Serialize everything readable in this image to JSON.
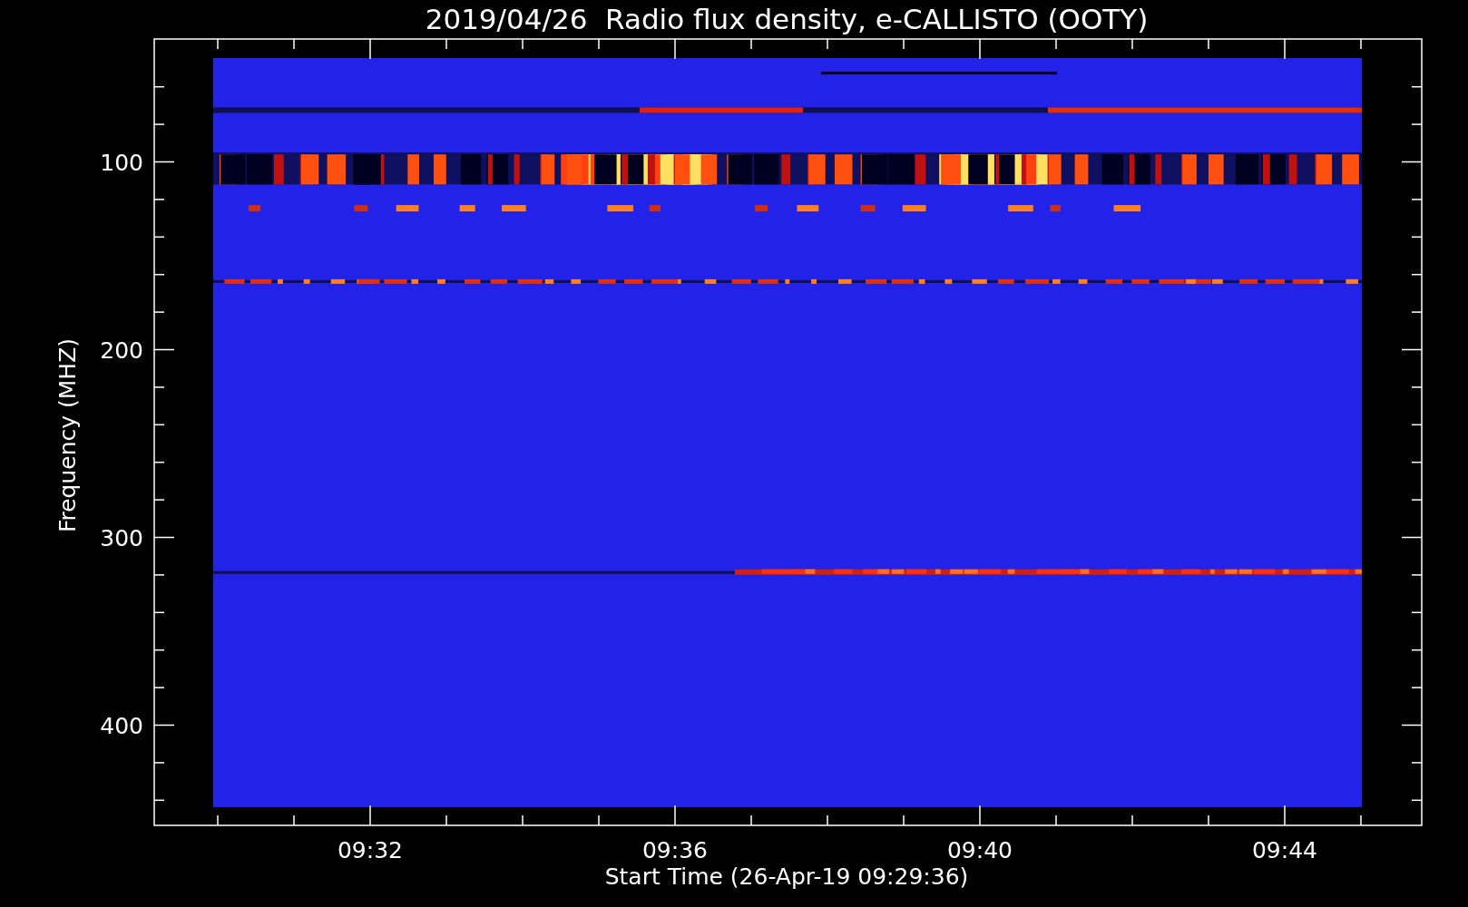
{
  "title": "2019/04/26  Radio flux density, e-CALLISTO (OOTY)",
  "y_axis": {
    "label": "Frequency (MHZ)",
    "ticks": [
      "100",
      "200",
      "300",
      "400"
    ]
  },
  "x_axis": {
    "label": "Start Time (26-Apr-19 09:29:36)",
    "ticks": [
      "09:32",
      "09:36",
      "09:40",
      "09:44"
    ]
  }
}
